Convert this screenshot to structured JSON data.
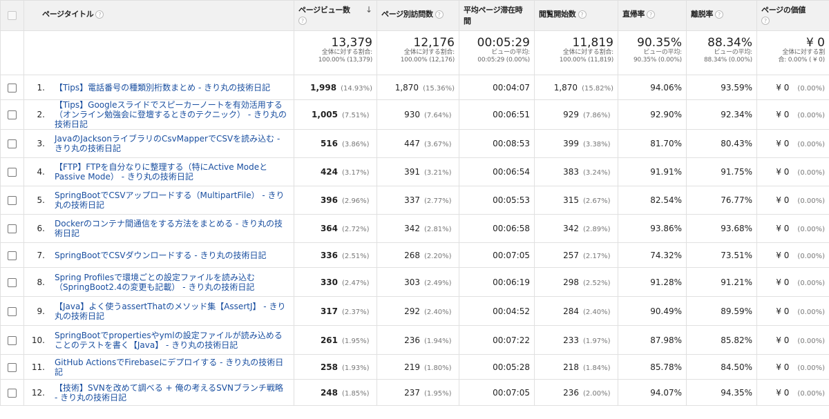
{
  "headers": {
    "title": "ページタイトル",
    "pageviews": "ページビュー数",
    "unique": "ページ別訪問数",
    "avg_time": "平均ページ滞在時間",
    "entrances": "閲覧開始数",
    "bounce": "直帰率",
    "exit": "離脱率",
    "value": "ページの価値"
  },
  "icons": {
    "help": "?",
    "sort": "↓"
  },
  "summary": {
    "pageviews": "13,379",
    "pageviews_sub1": "全体に対する割合:",
    "pageviews_sub2": "100.00% (13,379)",
    "unique": "12,176",
    "unique_sub1": "全体に対する割合:",
    "unique_sub2": "100.00% (12,176)",
    "avg_time": "00:05:29",
    "avg_time_sub1": "ビューの平均:",
    "avg_time_sub2": "00:05:29 (0.00%)",
    "entrances": "11,819",
    "entrances_sub1": "全体に対する割合:",
    "entrances_sub2": "100.00% (11,819)",
    "bounce": "90.35%",
    "bounce_sub1": "ビューの平均:",
    "bounce_sub2": "90.35% (0.00%)",
    "exit": "88.34%",
    "exit_sub1": "ビューの平均:",
    "exit_sub2": "88.34% (0.00%)",
    "value": "¥ 0",
    "value_sub1": "全体に対する割",
    "value_sub2": "合: 0.00% ( ¥ 0)"
  },
  "rows": [
    {
      "n": "1.",
      "title": "【Tips】電話番号の種類別桁数まとめ - きり丸の技術日記",
      "pv": "1,998",
      "pvp": "(14.93%)",
      "u": "1,870",
      "up": "(15.36%)",
      "t": "00:04:07",
      "e": "1,870",
      "ep": "(15.82%)",
      "b": "94.06%",
      "x": "93.59%",
      "v": "¥ 0",
      "vp": "(0.00%)"
    },
    {
      "n": "2.",
      "title": "【Tips】Googleスライドでスピーカーノートを有効活用する（オンライン勉強会に登壇するときのテクニック） - きり丸の技術日記",
      "pv": "1,005",
      "pvp": "(7.51%)",
      "u": "930",
      "up": "(7.64%)",
      "t": "00:06:51",
      "e": "929",
      "ep": "(7.86%)",
      "b": "92.90%",
      "x": "92.34%",
      "v": "¥ 0",
      "vp": "(0.00%)"
    },
    {
      "n": "3.",
      "title": "JavaのJacksonライブラリのCsvMapperでCSVを読み込む - きり丸の技術日記",
      "pv": "516",
      "pvp": "(3.86%)",
      "u": "447",
      "up": "(3.67%)",
      "t": "00:08:53",
      "e": "399",
      "ep": "(3.38%)",
      "b": "81.70%",
      "x": "80.43%",
      "v": "¥ 0",
      "vp": "(0.00%)"
    },
    {
      "n": "4.",
      "title": "【FTP】FTPを自分なりに整理する（特にActive ModeとPassive Mode） - きり丸の技術日記",
      "pv": "424",
      "pvp": "(3.17%)",
      "u": "391",
      "up": "(3.21%)",
      "t": "00:06:54",
      "e": "383",
      "ep": "(3.24%)",
      "b": "91.91%",
      "x": "91.75%",
      "v": "¥ 0",
      "vp": "(0.00%)"
    },
    {
      "n": "5.",
      "title": "SpringBootでCSVアップロードする（MultipartFile） - きり丸の技術日記",
      "pv": "396",
      "pvp": "(2.96%)",
      "u": "337",
      "up": "(2.77%)",
      "t": "00:05:53",
      "e": "315",
      "ep": "(2.67%)",
      "b": "82.54%",
      "x": "76.77%",
      "v": "¥ 0",
      "vp": "(0.00%)"
    },
    {
      "n": "6.",
      "title": "Dockerのコンテナ間通信をする方法をまとめる - きり丸の技術日記",
      "pv": "364",
      "pvp": "(2.72%)",
      "u": "342",
      "up": "(2.81%)",
      "t": "00:06:58",
      "e": "342",
      "ep": "(2.89%)",
      "b": "93.86%",
      "x": "93.68%",
      "v": "¥ 0",
      "vp": "(0.00%)"
    },
    {
      "n": "7.",
      "title": "SpringBootでCSVダウンロードする - きり丸の技術日記",
      "pv": "336",
      "pvp": "(2.51%)",
      "u": "268",
      "up": "(2.20%)",
      "t": "00:07:05",
      "e": "257",
      "ep": "(2.17%)",
      "b": "74.32%",
      "x": "73.51%",
      "v": "¥ 0",
      "vp": "(0.00%)"
    },
    {
      "n": "8.",
      "title": "Spring Profilesで環境ごとの設定ファイルを読み込む（SpringBoot2.4の変更も記載） - きり丸の技術日記",
      "pv": "330",
      "pvp": "(2.47%)",
      "u": "303",
      "up": "(2.49%)",
      "t": "00:06:19",
      "e": "298",
      "ep": "(2.52%)",
      "b": "91.28%",
      "x": "91.21%",
      "v": "¥ 0",
      "vp": "(0.00%)"
    },
    {
      "n": "9.",
      "title": "【Java】よく使うassertThatのメソッド集【AssertJ】 - きり丸の技術日記",
      "pv": "317",
      "pvp": "(2.37%)",
      "u": "292",
      "up": "(2.40%)",
      "t": "00:04:52",
      "e": "284",
      "ep": "(2.40%)",
      "b": "90.49%",
      "x": "89.59%",
      "v": "¥ 0",
      "vp": "(0.00%)"
    },
    {
      "n": "10.",
      "title": "SpringBootでpropertiesやymlの設定ファイルが読み込めることのテストを書く【Java】 - きり丸の技術日記",
      "pv": "261",
      "pvp": "(1.95%)",
      "u": "236",
      "up": "(1.94%)",
      "t": "00:07:22",
      "e": "233",
      "ep": "(1.97%)",
      "b": "87.98%",
      "x": "85.82%",
      "v": "¥ 0",
      "vp": "(0.00%)"
    },
    {
      "n": "11.",
      "title": "GitHub ActionsでFirebaseにデプロイする - きり丸の技術日記",
      "pv": "258",
      "pvp": "(1.93%)",
      "u": "219",
      "up": "(1.80%)",
      "t": "00:05:28",
      "e": "218",
      "ep": "(1.84%)",
      "b": "85.78%",
      "x": "84.50%",
      "v": "¥ 0",
      "vp": "(0.00%)"
    },
    {
      "n": "12.",
      "title": "【技術】SVNを改めて調べる + 俺の考えるSVNブランチ戦略 - きり丸の技術日記",
      "pv": "248",
      "pvp": "(1.85%)",
      "u": "237",
      "up": "(1.95%)",
      "t": "00:07:05",
      "e": "236",
      "ep": "(2.00%)",
      "b": "94.07%",
      "x": "94.35%",
      "v": "¥ 0",
      "vp": "(0.00%)"
    }
  ]
}
